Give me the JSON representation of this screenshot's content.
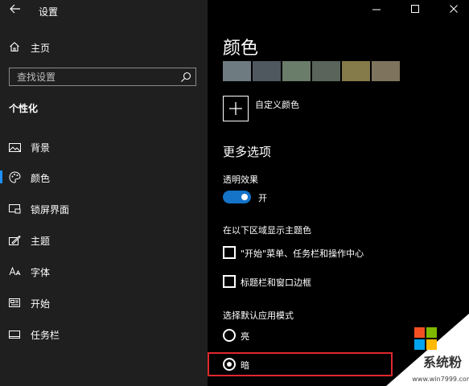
{
  "app": {
    "title": "设置"
  },
  "sidebar": {
    "home_label": "主页",
    "search_placeholder": "查找设置",
    "section_title": "个性化",
    "items": [
      {
        "label": "背景",
        "icon": "image-icon",
        "active": false
      },
      {
        "label": "颜色",
        "icon": "palette-icon",
        "active": true
      },
      {
        "label": "锁屏界面",
        "icon": "lock-screen-icon",
        "active": false
      },
      {
        "label": "主题",
        "icon": "brush-icon",
        "active": false
      },
      {
        "label": "字体",
        "icon": "font-icon",
        "active": false
      },
      {
        "label": "开始",
        "icon": "start-icon",
        "active": false
      },
      {
        "label": "任务栏",
        "icon": "taskbar-icon",
        "active": false
      }
    ]
  },
  "main": {
    "title": "颜色",
    "swatches": [
      "#6e7b80",
      "#4f575f",
      "#6a7c6a",
      "#5a645a",
      "#847a4a",
      "#7e745e"
    ],
    "custom_color_label": "自定义颜色",
    "more_options_title": "更多选项",
    "transparency": {
      "label": "透明效果",
      "state_label": "开",
      "on": true
    },
    "accent_surfaces": {
      "label": "在以下区域显示主题色",
      "options": [
        {
          "label": "\"开始\"菜单、任务栏和操作中心",
          "checked": false
        },
        {
          "label": "标题栏和窗口边框",
          "checked": false
        }
      ]
    },
    "app_mode": {
      "label": "选择默认应用模式",
      "options": [
        {
          "label": "亮",
          "selected": false
        },
        {
          "label": "暗",
          "selected": true
        }
      ]
    }
  },
  "watermark": {
    "brand": "系统粉",
    "url": "www.win7999.com"
  },
  "colors": {
    "accent": "#1573c8",
    "sidebar_bg": "#1f1f1f",
    "main_bg": "#000000",
    "highlight": "#e0282d"
  }
}
